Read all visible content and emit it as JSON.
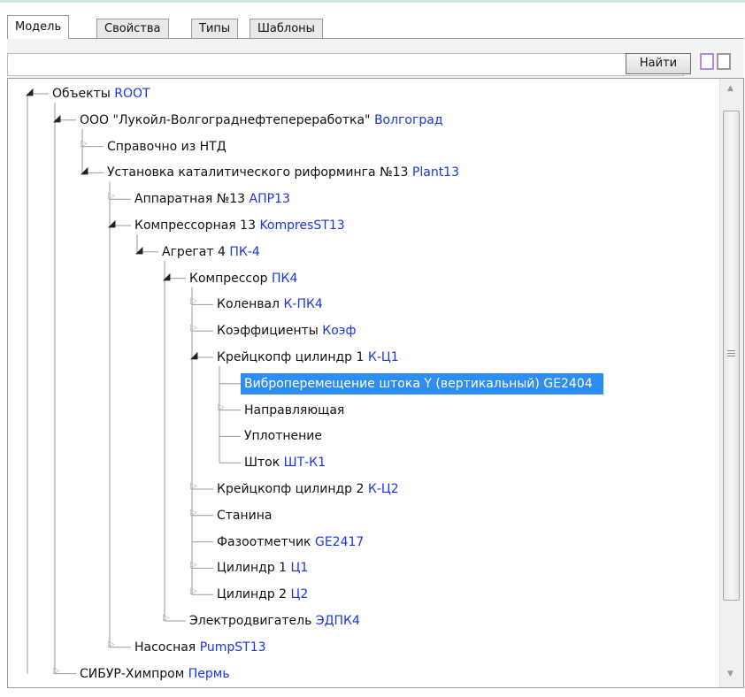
{
  "tabs": [
    {
      "label": "Модель"
    },
    {
      "label": "Свойства"
    },
    {
      "label": "Типы"
    },
    {
      "label": "Шаблоны"
    }
  ],
  "search": {
    "value": "",
    "button_label": "Найти"
  },
  "colors": {
    "code": "#1a34e8",
    "selected_bg": "#2e8df0",
    "tab_border": "#9a9a9a"
  },
  "icons": {
    "expanded": "triangle-expanded-icon",
    "collapsed": "triangle-collapsed-icon"
  },
  "tree": [
    {
      "label": "Объекты",
      "code": "ROOT",
      "state": "expanded"
    },
    {
      "label": "ООО \"Лукойл-Волгограднефтепереработка\"",
      "code": "Волгоград",
      "state": "expanded"
    },
    {
      "label": "Справочно из НТД",
      "code": "",
      "state": "collapsed"
    },
    {
      "label": "Установка каталитического риформинга №13",
      "code": "Plant13",
      "state": "expanded"
    },
    {
      "label": "Аппаратная №13",
      "code": "АПР13",
      "state": "collapsed"
    },
    {
      "label": "Компрессорная 13",
      "code": "KompresST13",
      "state": "expanded"
    },
    {
      "label": "Агрегат 4",
      "code": "ПК-4",
      "state": "expanded"
    },
    {
      "label": "Компрессор",
      "code": "ПК4",
      "state": "expanded"
    },
    {
      "label": "Коленвал",
      "code": "К-ПК4",
      "state": "collapsed"
    },
    {
      "label": "Коэффициенты",
      "code": "Коэф",
      "state": "collapsed"
    },
    {
      "label": "Крейцкопф цилиндр 1",
      "code": "К-Ц1",
      "state": "expanded"
    },
    {
      "label": "Виброперемещение штока Y (вертикальный)",
      "code": "GE2404",
      "state": "leaf",
      "selected": true
    },
    {
      "label": "Направляющая",
      "code": "",
      "state": "collapsed"
    },
    {
      "label": "Уплотнение",
      "code": "",
      "state": "leaf"
    },
    {
      "label": "Шток",
      "code": "ШТ-К1",
      "state": "leaf"
    },
    {
      "label": "Крейцкопф цилиндр 2",
      "code": "К-Ц2",
      "state": "collapsed"
    },
    {
      "label": "Станина",
      "code": "",
      "state": "collapsed"
    },
    {
      "label": "Фазоотметчик",
      "code": "GE2417",
      "state": "leaf"
    },
    {
      "label": "Цилиндр 1",
      "code": "Ц1",
      "state": "collapsed"
    },
    {
      "label": "Цилиндр 2",
      "code": "Ц2",
      "state": "collapsed"
    },
    {
      "label": "Электродвигатель",
      "code": "ЭДПК4",
      "state": "collapsed"
    },
    {
      "label": "Насосная",
      "code": "PumpST13",
      "state": "collapsed"
    },
    {
      "label": "СИБУР-Химпром",
      "code": "Пермь",
      "state": "collapsed"
    }
  ]
}
